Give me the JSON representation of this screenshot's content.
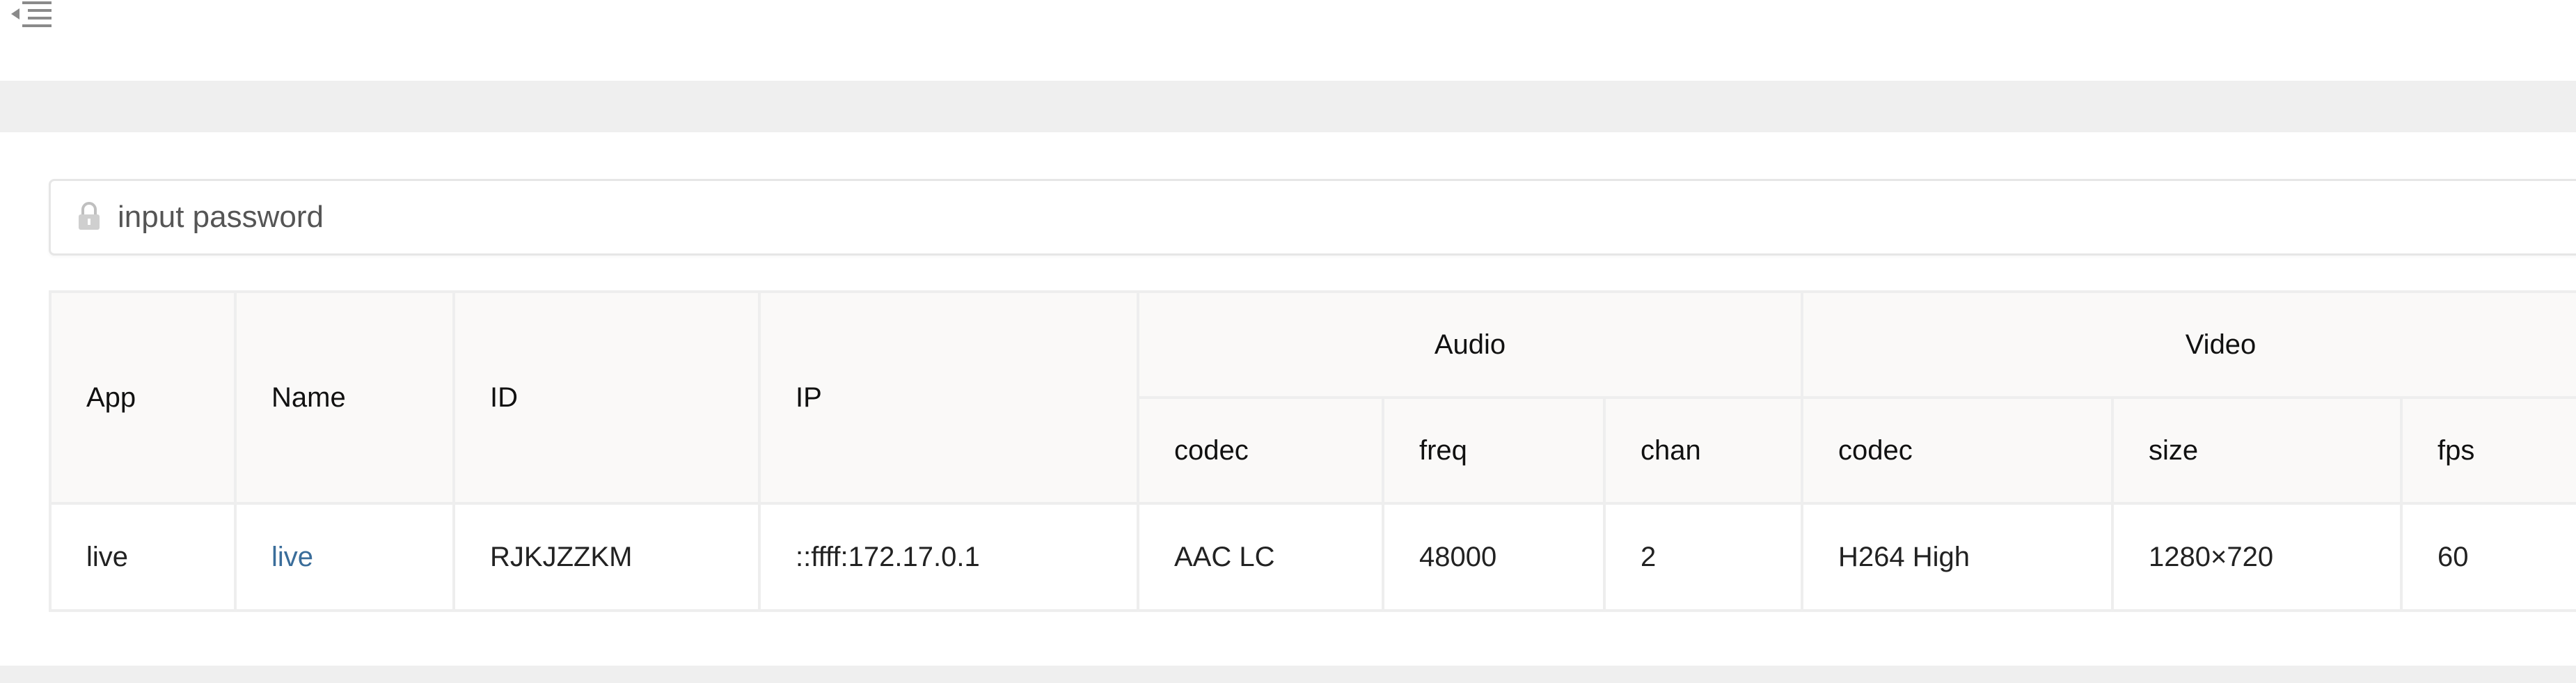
{
  "password": {
    "placeholder": "input password",
    "value": ""
  },
  "table": {
    "columns": {
      "app": "App",
      "name": "Name",
      "id": "ID",
      "ip": "IP",
      "audio_group": "Audio",
      "video_group": "Video",
      "audio_codec": "codec",
      "audio_freq": "freq",
      "audio_chan": "chan",
      "video_codec": "codec",
      "video_size": "size",
      "video_fps": "fps"
    },
    "rows": [
      {
        "app": "live",
        "name": "live",
        "id": "RJKJZZKM",
        "ip": "::ffff:172.17.0.1",
        "audio_codec": "AAC LC",
        "audio_freq": "48000",
        "audio_chan": "2",
        "video_codec": "H264 High",
        "video_size": "1280×720",
        "video_fps": "60"
      }
    ]
  },
  "icons": {
    "menu_toggle": "menu-fold-icon",
    "password_prefix": "lock-icon"
  },
  "colors": {
    "band": "#efefef",
    "header_bg": "#faf9f8",
    "border": "#eeeeee",
    "link": "#3a6d9a"
  }
}
